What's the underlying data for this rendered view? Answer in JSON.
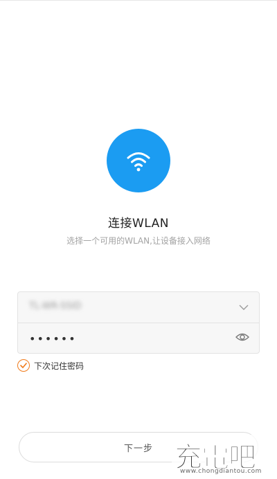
{
  "header": {
    "title": "连接WLAN",
    "subtitle": "选择一个可用的WLAN,让设备接入网络"
  },
  "form": {
    "ssid_value": "TL-WR-SSID",
    "password_value": "••••••"
  },
  "remember": {
    "label": "下次记住密码",
    "checked": true
  },
  "footer": {
    "next_label": "下一步"
  },
  "watermark": {
    "logo": "充電吧",
    "url": "www.chongdiantou.com"
  },
  "colors": {
    "accent_blue": "#1b9cf2",
    "check_orange": "#f07a1a"
  },
  "icons": {
    "hero": "wifi-icon",
    "dropdown": "chevron-down-icon",
    "reveal": "eye-icon",
    "check": "check-icon"
  }
}
